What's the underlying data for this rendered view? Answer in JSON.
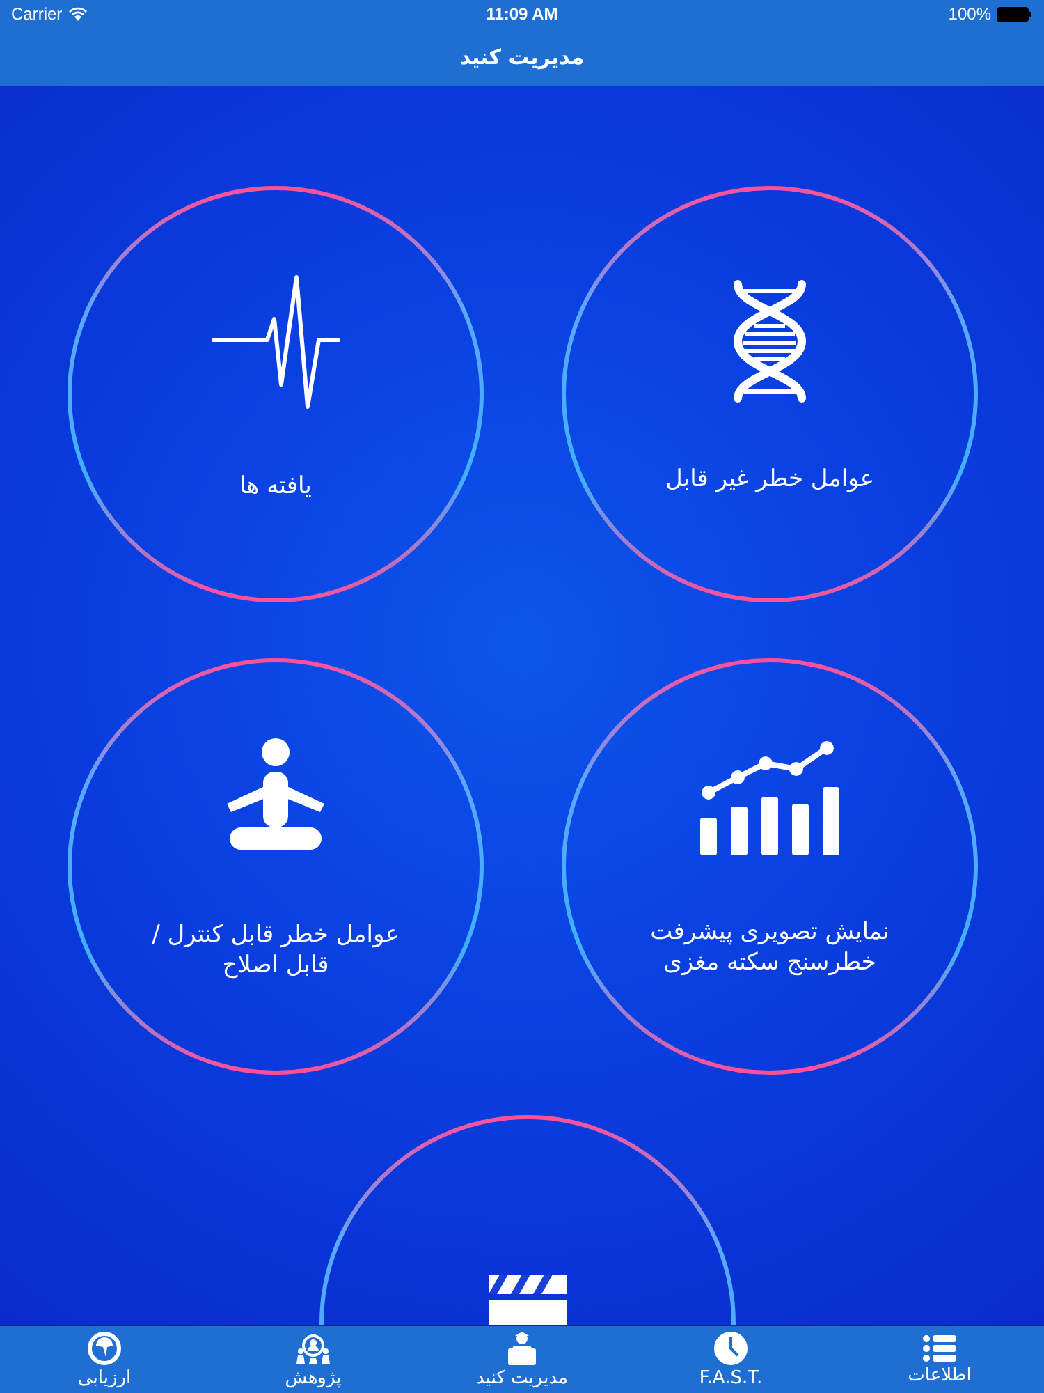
{
  "status_bar": {
    "carrier": "Carrier",
    "time": "11:09 AM",
    "battery": "100%"
  },
  "nav_bar": {
    "title": "مدیریت کنید"
  },
  "tiles": [
    {
      "kind": "dna",
      "label": "عوامل خطر غیر قابل"
    },
    {
      "kind": "heartbeat",
      "label": "یافته ها"
    },
    {
      "kind": "chart",
      "label": "نمایش تصویری پیشرفت\nخطرسنج سکته مغزی"
    },
    {
      "kind": "meditation",
      "label": "عوامل خطر قابل کنترل /\nقابل اصلاح"
    },
    {
      "kind": "clapperboard"
    }
  ],
  "tab_bar": [
    {
      "kind": "list",
      "label": "اطلاعات"
    },
    {
      "kind": "clock",
      "label": "F.A.S.T."
    },
    {
      "kind": "laptop",
      "label": "مدیریت کنید"
    },
    {
      "kind": "people",
      "label": "پژوهش"
    },
    {
      "kind": "gauge",
      "label": "ارزیابی"
    }
  ]
}
